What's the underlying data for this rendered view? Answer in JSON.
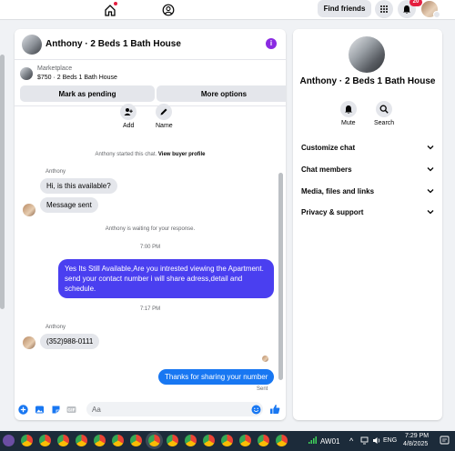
{
  "topbar": {
    "find_friends_label": "Find friends",
    "notifications_count": "20",
    "icons": [
      "home-icon",
      "profile-icon",
      "menu-grid-icon",
      "bell-icon",
      "avatar"
    ]
  },
  "conversation": {
    "title": "Anthony · 2 Beds 1 Bath House",
    "marketplace_label": "Marketplace",
    "listing": "$750 · 2 Beds 1 Bath House",
    "mark_pending_label": "Mark as pending",
    "more_options_label": "More options"
  },
  "quick_actions": {
    "add_label": "Add",
    "name_label": "Name"
  },
  "messages": {
    "started_text": "Anthony started this chat.",
    "view_profile_link": "View buyer profile",
    "sender_name_1": "Anthony",
    "msg_1": "Hi, is this available?",
    "msg_2": "Message sent",
    "waiting_text": "Anthony is waiting for your response.",
    "time_1": "7:00 PM",
    "reply_1": "Yes Its Still Available,Are you intrested viewing the Apartment. send your contact number i will share adress,detail and schedule.",
    "time_2": "7:17 PM",
    "sender_name_2": "Anthony",
    "msg_3": "(352)988-0111",
    "reply_2": "Thanks for sharing your number",
    "status": "Sent"
  },
  "composer": {
    "placeholder": "Aa"
  },
  "right_panel": {
    "title": "Anthony · 2 Beds 1 Bath House",
    "mute_label": "Mute",
    "search_label": "Search",
    "sections": [
      "Customize chat",
      "Chat members",
      "Media, files and links",
      "Privacy & support"
    ]
  },
  "taskbar": {
    "network_label": "AW01",
    "language": "ENG",
    "time": "7:29 PM",
    "date": "4/8/2025"
  },
  "colors": {
    "accent": "#1877f2",
    "outgoing_bubble": "#4a3ff0",
    "badge": "#e41e3f",
    "info_icon": "#8a2be2"
  }
}
